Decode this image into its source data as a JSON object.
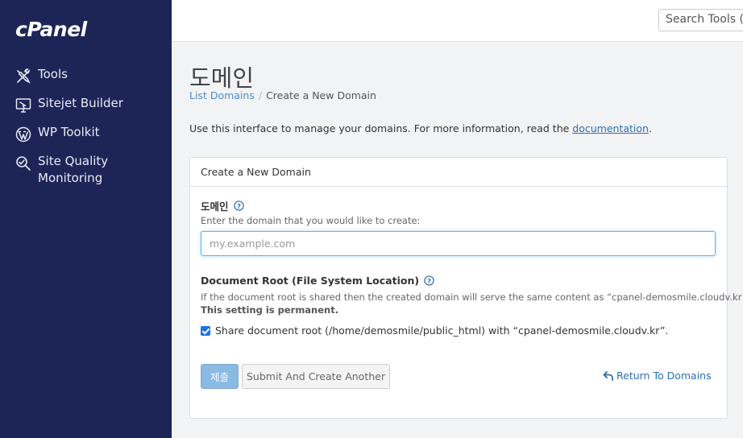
{
  "brand": {
    "logo": "cPanel"
  },
  "sidebar": {
    "items": [
      {
        "label": "Tools",
        "icon": "tools-icon"
      },
      {
        "label": "Sitejet Builder",
        "icon": "sitejet-monitor-icon"
      },
      {
        "label": "WP Toolkit",
        "icon": "wordpress-icon"
      },
      {
        "label": "Site Quality Monitoring",
        "icon": "magnifier-icon"
      }
    ]
  },
  "topbar": {
    "search_placeholder": "Search Tools (/"
  },
  "page": {
    "title": "도메인",
    "breadcrumb": {
      "parent": "List Domains",
      "separator": "/",
      "current": "Create a New Domain"
    },
    "intro_text": "Use this interface to manage your domains. For more information, read the ",
    "intro_link": "documentation",
    "intro_end": "."
  },
  "form": {
    "panel_title": "Create a New Domain",
    "domain_label": "도메인",
    "domain_hint": "Enter the domain that you would like to create:",
    "domain_placeholder": "my.example.com",
    "docroot_label": "Document Root (File System Location)",
    "docroot_hint": "If the document root is shared then the created domain will serve the same content as “cpanel-demosmile.cloudv.kr”.",
    "permanent_note": "This setting is permanent.",
    "share_checkbox_label": "Share document root (/home/demosmile/public_html) with “cpanel-demosmile.cloudv.kr”.",
    "share_checked": true,
    "submit_label": "제출",
    "submit_another_label": "Submit And Create Another",
    "return_label": "Return To Domains"
  },
  "colors": {
    "sidebar_bg": "#1d2556",
    "link": "#2a6fb2",
    "submit_bg": "#8ab9e2",
    "checkbox": "#1a73e8"
  }
}
